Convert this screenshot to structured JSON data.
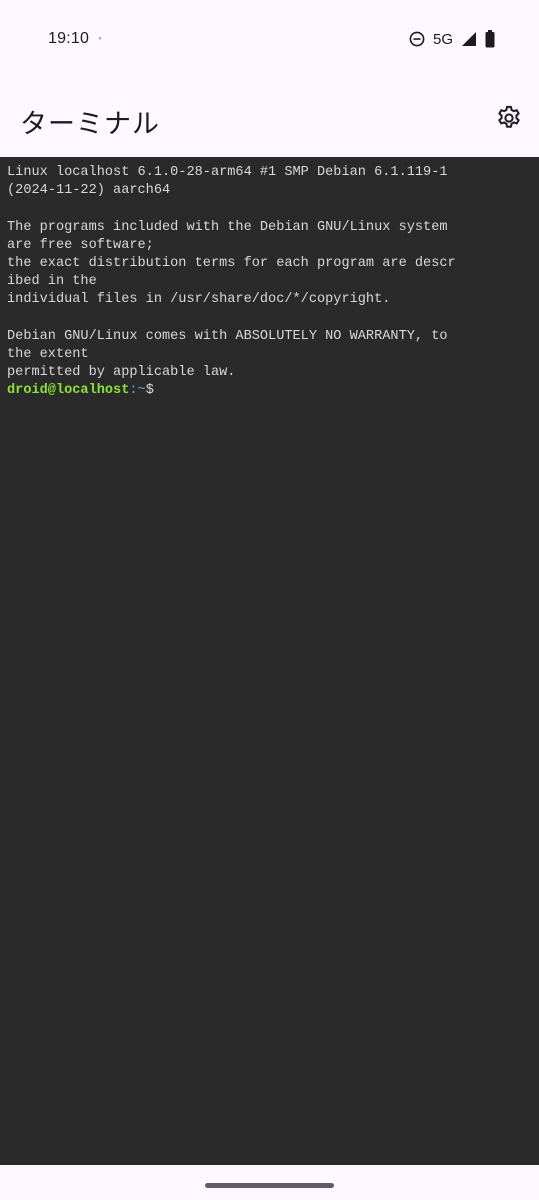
{
  "status_bar": {
    "time": "19:10",
    "notification": "ﾟ",
    "network": "5G"
  },
  "app_bar": {
    "title": "ターミナル"
  },
  "terminal": {
    "output": "Linux localhost 6.1.0-28-arm64 #1 SMP Debian 6.1.119-1\n(2024-11-22) aarch64\n\nThe programs included with the Debian GNU/Linux system\nare free software;\nthe exact distribution terms for each program are descr\nibed in the\nindividual files in /usr/share/doc/*/copyright.\n\nDebian GNU/Linux comes with ABSOLUTELY NO WARRANTY, to\nthe extent\npermitted by applicable law.\n",
    "prompt_user": "droid@localhost",
    "prompt_path": ":~",
    "prompt_symbol": "$"
  },
  "colors": {
    "terminal_bg": "#2a2a2a",
    "terminal_fg": "#d8d8d8",
    "prompt_user": "#8ae234",
    "prompt_path": "#729fcf",
    "surface": "#fdf7ff"
  },
  "icons": {
    "dnd": "do-not-disturb-icon",
    "signal": "cell-signal-icon",
    "battery": "battery-icon",
    "settings": "gear-icon"
  }
}
